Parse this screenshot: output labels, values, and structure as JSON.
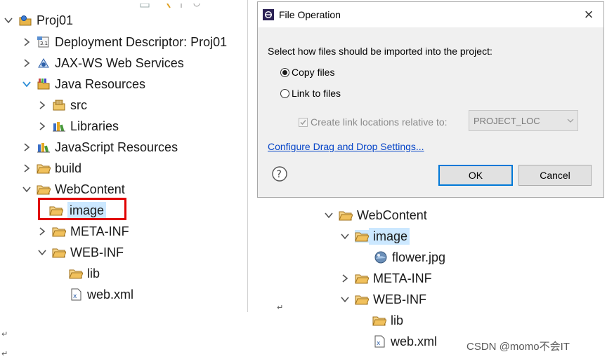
{
  "left_tree": {
    "rows": [
      {
        "label": "Proj01",
        "icon": "project-icon",
        "chevron": "down"
      },
      {
        "label": "Deployment Descriptor: Proj01",
        "icon": "deployment-descriptor-icon",
        "chevron": "right"
      },
      {
        "label": "JAX-WS Web Services",
        "icon": "web-services-icon",
        "chevron": "right"
      },
      {
        "label": "Java Resources",
        "icon": "java-resources-icon",
        "chevron": "down-blue"
      },
      {
        "label": "src",
        "icon": "package-folder-icon",
        "chevron": "right"
      },
      {
        "label": "Libraries",
        "icon": "libraries-icon",
        "chevron": "right"
      },
      {
        "label": "JavaScript Resources",
        "icon": "libraries-icon",
        "chevron": "right"
      },
      {
        "label": "build",
        "icon": "folder-icon",
        "chevron": "right"
      },
      {
        "label": "WebContent",
        "icon": "folder-icon",
        "chevron": "down"
      },
      {
        "label": "image",
        "icon": "folder-icon",
        "chevron": "none"
      },
      {
        "label": "META-INF",
        "icon": "folder-icon",
        "chevron": "right"
      },
      {
        "label": "WEB-INF",
        "icon": "folder-icon",
        "chevron": "down"
      },
      {
        "label": "lib",
        "icon": "folder-icon",
        "chevron": "none"
      },
      {
        "label": "web.xml",
        "icon": "xml-file-icon",
        "chevron": "none"
      }
    ],
    "highlighted": "image"
  },
  "dialog": {
    "title": "File Operation",
    "close": "×",
    "prompt": "Select how files should be imported into the project:",
    "option_copy": "Copy files",
    "option_link": "Link to files",
    "selected_option": "Copy files",
    "checkbox_label": "Create link locations relative to:",
    "checkbox_checked": true,
    "checkbox_enabled": false,
    "combo_value": "PROJECT_LOC",
    "link_text": "Configure Drag and Drop Settings...",
    "ok_label": "OK",
    "cancel_label": "Cancel",
    "help_glyph": "?"
  },
  "right_tree": {
    "rows": [
      {
        "label": "WebContent",
        "icon": "folder-icon",
        "chevron": "down"
      },
      {
        "label": "image",
        "icon": "folder-icon",
        "chevron": "down",
        "selected": true
      },
      {
        "label": "flower.jpg",
        "icon": "image-file-icon",
        "chevron": "none"
      },
      {
        "label": "META-INF",
        "icon": "folder-icon",
        "chevron": "right"
      },
      {
        "label": "WEB-INF",
        "icon": "folder-icon",
        "chevron": "down"
      },
      {
        "label": "lib",
        "icon": "folder-icon",
        "chevron": "none"
      },
      {
        "label": "web.xml",
        "icon": "xml-file-icon",
        "chevron": "none"
      }
    ]
  },
  "watermark": "CSDN @momo不会IT",
  "colors": {
    "selection": "#cce8ff",
    "highlight_box": "#e00000",
    "link": "#0645c8",
    "ok_border": "#0078d7",
    "folder": "#e8b54a"
  }
}
